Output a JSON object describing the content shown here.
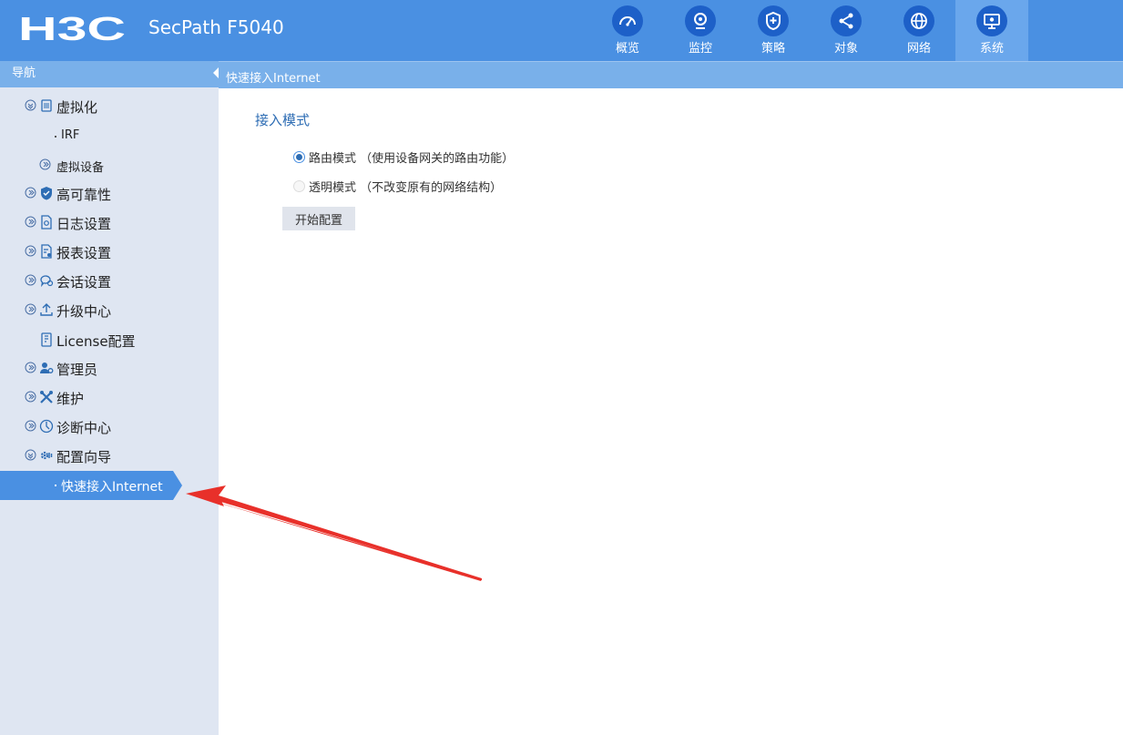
{
  "header": {
    "brand": "H3C",
    "product": "SecPath F5040",
    "tabs": [
      {
        "label": "概览",
        "icon": "gauge-icon"
      },
      {
        "label": "监控",
        "icon": "webcam-icon"
      },
      {
        "label": "策略",
        "icon": "shield-plus-icon"
      },
      {
        "label": "对象",
        "icon": "share-nodes-icon"
      },
      {
        "label": "网络",
        "icon": "globe-icon"
      },
      {
        "label": "系统",
        "icon": "monitor-gear-icon",
        "active": true
      }
    ]
  },
  "sidebar": {
    "title": "导航",
    "items": [
      {
        "label": "虚拟化",
        "icon": "virtual-icon",
        "expanded": true
      },
      {
        "label": "IRF"
      },
      {
        "label": "虚拟设备"
      },
      {
        "label": "高可靠性",
        "icon": "shield-check-icon"
      },
      {
        "label": "日志设置",
        "icon": "log-file-icon"
      },
      {
        "label": "报表设置",
        "icon": "report-icon"
      },
      {
        "label": "会话设置",
        "icon": "session-icon"
      },
      {
        "label": "升级中心",
        "icon": "upload-icon"
      },
      {
        "label": "License配置",
        "icon": "license-icon"
      },
      {
        "label": "管理员",
        "icon": "admin-user-icon"
      },
      {
        "label": "维护",
        "icon": "tools-icon"
      },
      {
        "label": "诊断中心",
        "icon": "diagnose-icon"
      },
      {
        "label": "配置向导",
        "icon": "wizard-gear-icon",
        "expanded": true
      },
      {
        "label": "快速接入Internet",
        "active": true
      }
    ]
  },
  "breadcrumb": "快速接入Internet",
  "main": {
    "section_title": "接入模式",
    "options": [
      {
        "label": "路由模式",
        "hint": "（使用设备网关的路由功能）",
        "checked": true
      },
      {
        "label": "透明模式",
        "hint": "（不改变原有的网络结构）",
        "checked": false
      }
    ],
    "start_button": "开始配置"
  },
  "colors": {
    "primary": "#4a90e2",
    "active_tab": "#6aa7ec",
    "tab_circle": "#1d60c8",
    "sidebar": "#dfe6f2",
    "annotation": "#e8302a"
  }
}
